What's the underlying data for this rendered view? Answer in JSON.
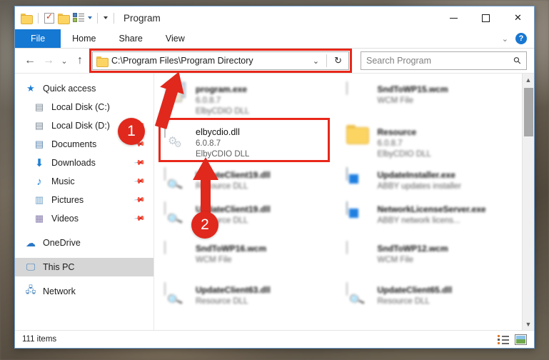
{
  "window": {
    "title": "Program",
    "quick_access": [
      "folder-icon",
      "properties-icon",
      "new-folder-icon",
      "view-options-icon",
      "customize-chevron-icon"
    ],
    "controls": {
      "minimize": "minimize-icon",
      "maximize": "maximize-icon",
      "close": "close-icon"
    }
  },
  "ribbon": {
    "tabs": [
      {
        "label": "File",
        "active": true
      },
      {
        "label": "Home",
        "active": false
      },
      {
        "label": "Share",
        "active": false
      },
      {
        "label": "View",
        "active": false
      }
    ],
    "collapse_icon": "chevron-down-icon",
    "help_label": "?"
  },
  "address_bar": {
    "back_icon": "←",
    "forward_icon": "→",
    "recent_icon": "⌄",
    "up_icon": "↑",
    "folder_icon": "folder-icon",
    "path": "C:\\Program Files\\Program Directory",
    "dropdown_icon": "⌄",
    "refresh_icon": "↻",
    "highlighted": true
  },
  "search": {
    "placeholder": "Search Program",
    "icon": "search-icon"
  },
  "sidebar": {
    "items": [
      {
        "label": "Quick access",
        "icon": "★",
        "indent": false,
        "pinned": false,
        "selected": false
      },
      {
        "label": "Local Disk (C:)",
        "icon": "▤",
        "indent": true,
        "pinned": false,
        "selected": false
      },
      {
        "label": "Local Disk (D:)",
        "icon": "▤",
        "indent": true,
        "pinned": true,
        "selected": false
      },
      {
        "label": "Documents",
        "icon": "▤",
        "indent": true,
        "pinned": true,
        "selected": false
      },
      {
        "label": "Downloads",
        "icon": "⬇",
        "indent": true,
        "pinned": true,
        "selected": false
      },
      {
        "label": "Music",
        "icon": "♪",
        "indent": true,
        "pinned": true,
        "selected": false
      },
      {
        "label": "Pictures",
        "icon": "▥",
        "indent": true,
        "pinned": true,
        "selected": false
      },
      {
        "label": "Videos",
        "icon": "▦",
        "indent": true,
        "pinned": true,
        "selected": false
      },
      {
        "label": "OneDrive",
        "icon": "☁",
        "indent": false,
        "pinned": false,
        "selected": false
      },
      {
        "label": "This PC",
        "icon": "🖥",
        "indent": false,
        "pinned": false,
        "selected": true
      },
      {
        "label": "Network",
        "icon": "🖧",
        "indent": false,
        "pinned": false,
        "selected": false
      }
    ]
  },
  "files": [
    {
      "name": "program.exe",
      "version": "6.0.8.7",
      "type": "ElbyCDIO DLL",
      "icon": "program-icon",
      "blurred": true,
      "selected": false
    },
    {
      "name": "SndToWP15.wcm",
      "version": "",
      "type": "WCM File",
      "icon": "document-icon",
      "blurred": true,
      "selected": false
    },
    {
      "name": "elbycdio.dll",
      "version": "6.0.8.7",
      "type": "ElbyCDIO DLL",
      "icon": "gear-document-icon",
      "blurred": false,
      "selected": true
    },
    {
      "name": "Resource",
      "version": "6.0.8.7",
      "type": "ElbyCDIO DLL",
      "icon": "folder-icon",
      "blurred": true,
      "selected": false
    },
    {
      "name": "UpdateClient19.dll",
      "version": "",
      "type": "Resource DLL",
      "icon": "search-document-icon",
      "blurred": true,
      "selected": false
    },
    {
      "name": "UpdateInstaller.exe",
      "version": "",
      "type": "ABBY updates installer",
      "icon": "application-icon",
      "blurred": true,
      "selected": false
    },
    {
      "name": "UpdateClient19.dll",
      "version": "",
      "type": "Resource DLL",
      "icon": "search-document-icon",
      "blurred": true,
      "selected": false
    },
    {
      "name": "NetworkLicenseServer.exe",
      "version": "",
      "type": "ABBY network licens...",
      "icon": "application-icon",
      "blurred": true,
      "selected": false
    },
    {
      "name": "SndToWP16.wcm",
      "version": "",
      "type": "WCM File",
      "icon": "document-icon",
      "blurred": true,
      "selected": false
    },
    {
      "name": "SndToWP12.wcm",
      "version": "",
      "type": "WCM File",
      "icon": "document-icon",
      "blurred": true,
      "selected": false
    },
    {
      "name": "UpdateClient63.dll",
      "version": "",
      "type": "Resource DLL",
      "icon": "search-document-icon",
      "blurred": true,
      "selected": false
    },
    {
      "name": "UpdateClient65.dll",
      "version": "",
      "type": "Resource DLL",
      "icon": "search-document-icon",
      "blurred": true,
      "selected": false
    }
  ],
  "status_bar": {
    "item_count": "111 items",
    "view_buttons": [
      "details-view-icon",
      "large-icons-view-icon"
    ]
  },
  "callouts": [
    {
      "number": "1",
      "target": "address-bar"
    },
    {
      "number": "2",
      "target": "elbycdio-dll-file"
    }
  ],
  "colors": {
    "accent_red": "#e0281d",
    "file_tab_blue": "#1578d3",
    "selection_blue": "#cde0f5",
    "help_blue": "#1877d2"
  },
  "scrollbar": {
    "up_icon": "▲",
    "down_icon": "▼"
  }
}
